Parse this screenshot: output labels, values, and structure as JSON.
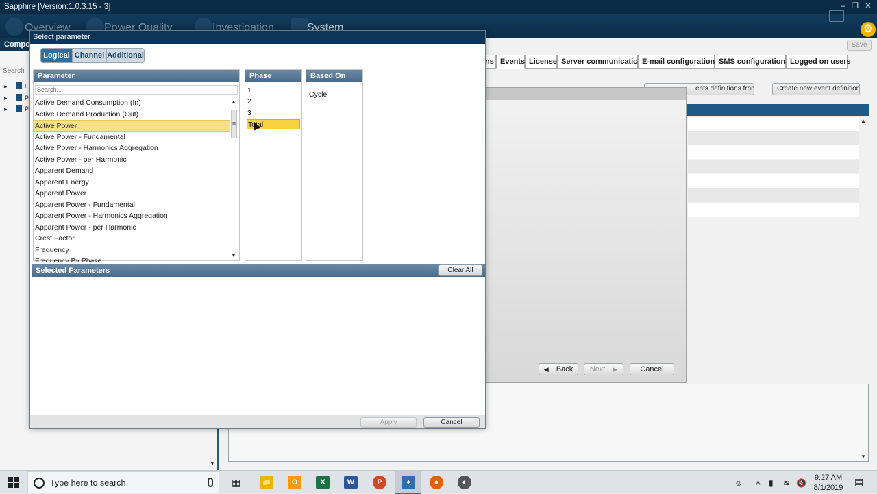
{
  "window": {
    "title": "Sapphire [Version:1.0.3.15 - 3]",
    "minimize_icon": "minimize-icon",
    "restore_icon": "restore-icon",
    "close_icon": "close-icon"
  },
  "main_nav": [
    "Overview",
    "Power Quality",
    "Investigation",
    "System"
  ],
  "left_panel": {
    "header": "Compon",
    "search_placeholder": "Search",
    "tree": [
      {
        "label": "L"
      },
      {
        "label": "P"
      },
      {
        "label": "P"
      }
    ]
  },
  "background": {
    "tabs": [
      "ns",
      "Events",
      "License",
      "Server communication",
      "E-mail configurations",
      "SMS configurations",
      "Logged on users"
    ],
    "save_label": "Save",
    "import_button": "ents definitions from file",
    "create_button": "Create new event definitions",
    "wizard": {
      "back_label": "Back",
      "next_label": "Next",
      "cancel_label": "Cancel"
    }
  },
  "dialog": {
    "title": "Select parameter",
    "tabs": [
      "Logical",
      "Channel",
      "Additional"
    ],
    "active_tab": "Logical",
    "columns": {
      "parameter": "Parameter",
      "phase": "Phase",
      "based_on": "Based On"
    },
    "search_placeholder": "Search...",
    "parameters": [
      "Active Demand Consumption (In)",
      "Active Demand Production (Out)",
      "Active Power",
      "Active Power - Fundamental",
      "Active Power - Harmonics Aggregation",
      "Active Power - per Harmonic",
      "Apparent Demand",
      "Apparent Energy",
      "Apparent Power",
      "Apparent Power - Fundamental",
      "Apparent Power - Harmonics Aggregation",
      "Apparent Power - per Harmonic",
      "Crest Factor",
      "Frequency",
      "Frequency By Phase"
    ],
    "selected_parameter": "Active Power",
    "phases": [
      "1",
      "2",
      "3",
      "Total"
    ],
    "selected_phase": "Total",
    "based_on": [
      "Cycle"
    ],
    "selected_parameters_header": "Selected Parameters",
    "clear_all_label": "Clear All",
    "apply_label": "Apply",
    "cancel_label": "Cancel"
  },
  "taskbar": {
    "search_placeholder": "Type here to search",
    "time": "9:27 AM",
    "date": "8/1/2019",
    "colors": {
      "file_explorer": "#f2b300",
      "outlook": "#f39c12",
      "excel": "#1e7145",
      "word": "#2b579a",
      "powerpoint": "#d24726",
      "sapphire": "#2f6fb0",
      "firefox": "#e66000",
      "other": "#555555"
    }
  },
  "colors": {
    "title_bar": "#0a2b45",
    "dialog_header": "#0e3555",
    "column_header": "#4a6b88",
    "selection_highlight": "#f7d23e"
  }
}
